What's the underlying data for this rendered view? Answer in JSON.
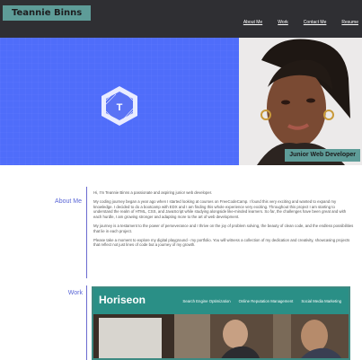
{
  "header": {
    "brand": "Teannie Binns",
    "nav": [
      "About Me",
      "Work",
      "Contact Me",
      "Resume"
    ]
  },
  "hero": {
    "logo_letter": "T",
    "badge": "Junior Web Developer"
  },
  "about": {
    "label": "About Me",
    "paragraphs": [
      "Hi, I'm Teannie Binns a passionate and aspiring junior web developer.",
      "My coding journey began a year ago when I started looking at courses on FreeCodeCamp. I found this very exciting and wanted to expand my knowledge. I decided to do a bootcamp with EDX and I am finding this whole experience very exciting. Throughout this project I am starting to understand the realm of HTML, CSS, and JavaScript while studying alongside like-minded learners. So far, the challenges have been great and with each hurdle, I am growing stronger and adapting more to the art of web development.",
      "My journey is a testament to the power of perseverance and I thrive on the joy of problem solving, the beauty of clean code, and the endless possibilities that lie in each project.",
      "Please take a moment to explore my digital playground - my portfolio. You will witness a collection of my dedication and creativity, showcasing projects that reflect not just lines of code but a journey of my growth."
    ]
  },
  "work": {
    "label": "Work",
    "project": {
      "title": "Horiseon",
      "nav": [
        "Search Engine Optimization",
        "Online Reputation Management",
        "Social Media Marketing"
      ]
    }
  },
  "colors": {
    "header_bg": "#2f2f33",
    "accent_teal": "#5e9c98",
    "hero_blue": "#4f6dfa",
    "section_label": "#5a66d6"
  }
}
